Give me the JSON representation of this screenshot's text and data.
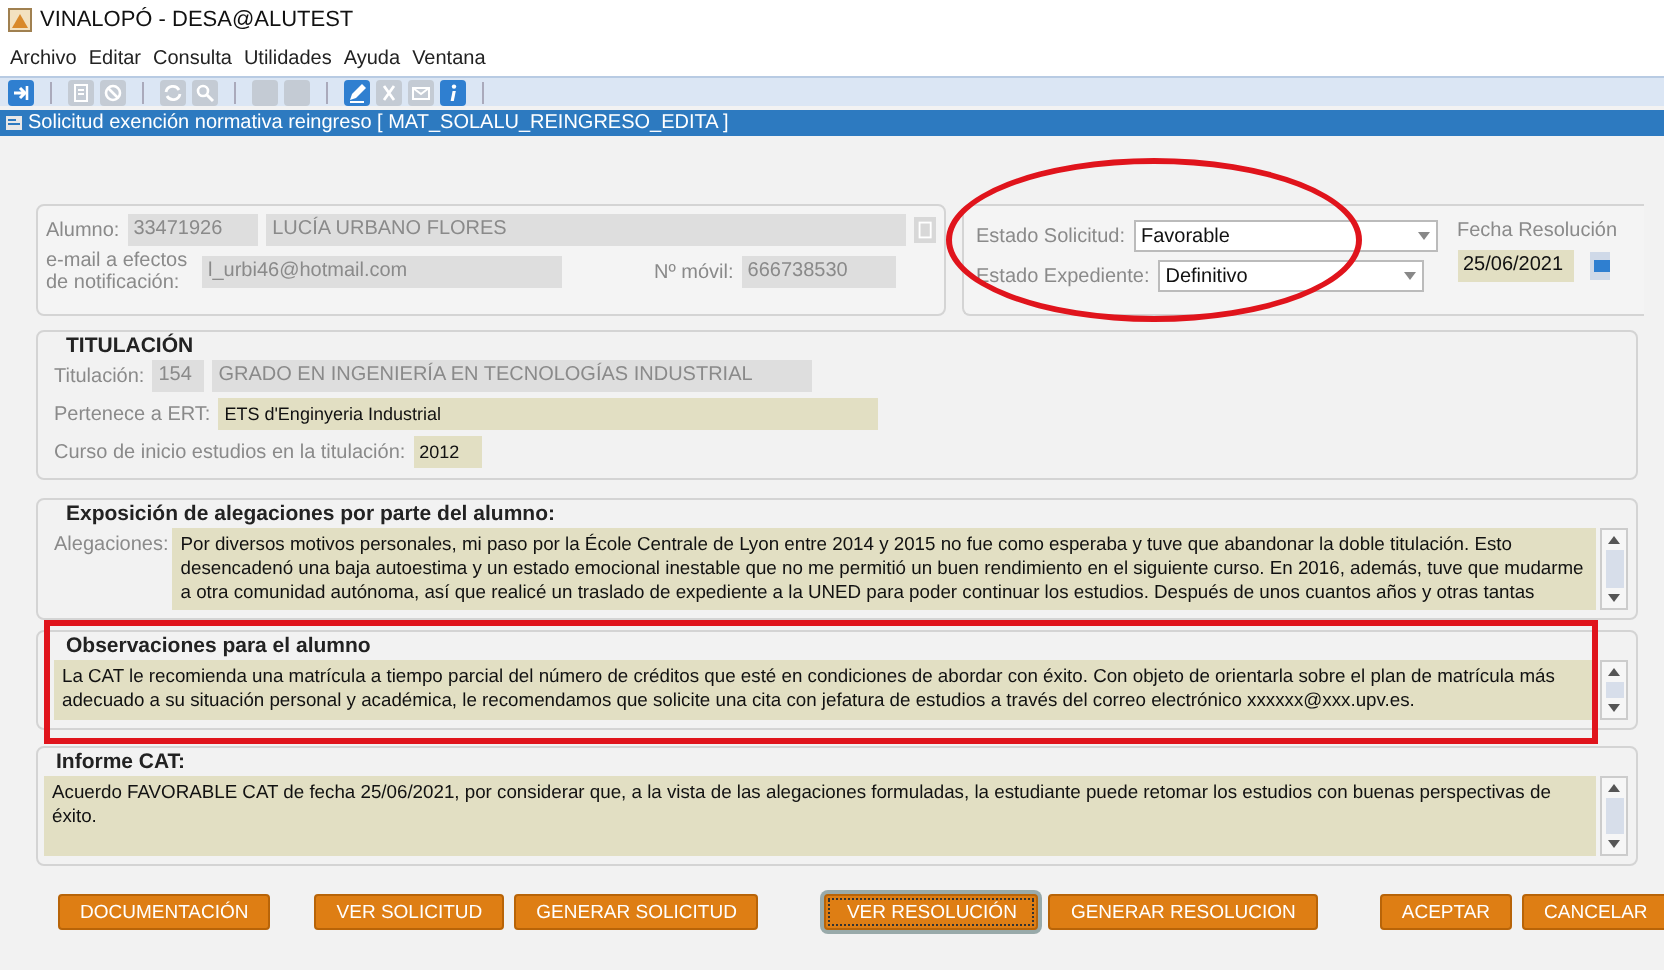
{
  "window": {
    "title": "VINALOPÓ - DESA@ALUTEST"
  },
  "menu": [
    "Archivo",
    "Editar",
    "Consulta",
    "Utilidades",
    "Ayuda",
    "Ventana"
  ],
  "toolbar": [
    {
      "kind": "exit",
      "disabled": false
    },
    {
      "kind": "separator"
    },
    {
      "kind": "list",
      "disabled": true
    },
    {
      "kind": "cancel",
      "disabled": true
    },
    {
      "kind": "separator"
    },
    {
      "kind": "refresh",
      "disabled": true
    },
    {
      "kind": "search",
      "disabled": true
    },
    {
      "kind": "separator"
    },
    {
      "kind": "blank",
      "disabled": true
    },
    {
      "kind": "blank",
      "disabled": true
    },
    {
      "kind": "separator"
    },
    {
      "kind": "edit",
      "disabled": false
    },
    {
      "kind": "excel",
      "disabled": true
    },
    {
      "kind": "mail",
      "disabled": true
    },
    {
      "kind": "info",
      "disabled": false
    },
    {
      "kind": "separator"
    }
  ],
  "form": {
    "title": "Solicitud exención normativa reingreso [ MAT_SOLALU_REINGRESO_EDITA ]"
  },
  "student": {
    "label": "Alumno:",
    "id": "33471926",
    "name": "LUCÍA URBANO FLORES",
    "email_label": "e-mail a efectos de notificación:",
    "email": "l_urbi46@hotmail.com",
    "mobile_label": "Nº móvil:",
    "mobile": "666738530"
  },
  "status": {
    "request_label": "Estado Solicitud:",
    "request": "Favorable",
    "file_label": "Estado Expediente:",
    "file": "Definitivo",
    "date_label": "Fecha Resolución",
    "date": "25/06/2021"
  },
  "degree": {
    "heading": "TITULACIÓN",
    "label": "Titulación:",
    "code": "154",
    "name": "GRADO EN INGENIERÍA EN TECNOLOGÍAS INDUSTRIAL",
    "ert_label": "Pertenece a ERT:",
    "ert": "ETS d'Enginyeria Industrial",
    "start_label": "Curso de inicio estudios en la titulación:",
    "start": "2012"
  },
  "allegations": {
    "heading": "Exposición de alegaciones por parte del alumno:",
    "label": "Alegaciones:",
    "text": "Por diversos motivos personales, mi paso por la École Centrale de Lyon entre 2014 y 2015 no fue como esperaba y tuve que abandonar la doble titulación. Esto desencadenó una baja autoestima y un estado emocional inestable que no me permitió un buen rendimiento en el siguiente curso. En 2016, además, tuve que mudarme a otra comunidad autónoma, así que realicé un traslado de expediente a la UNED para poder continuar los estudios. Después de unos cuantos años y otras tantas"
  },
  "observations": {
    "heading": "Observaciones para el alumno",
    "text": "La CAT le recomienda una matrícula a tiempo parcial del número de créditos que esté en condiciones de abordar con éxito. Con objeto de orientarla sobre el plan de matrícula más adecuado a su situación personal y académica, le recomendamos que solicite una cita con jefatura de estudios a través del correo electrónico xxxxxx@xxx.upv.es."
  },
  "report": {
    "heading": "Informe CAT:",
    "text": "Acuerdo FAVORABLE CAT de fecha 25/06/2021, por considerar que, a la vista de las alegaciones formuladas,  la estudiante puede retomar los estudios con buenas perspectivas de éxito."
  },
  "buttons": [
    {
      "label": "DOCUMENTACIÓN",
      "focused": false
    },
    {
      "label": "VER SOLICITUD",
      "focused": false
    },
    {
      "label": "GENERAR SOLICITUD",
      "focused": false
    },
    {
      "label": "VER RESOLUCIÓN",
      "focused": true
    },
    {
      "label": "GENERAR RESOLUCION",
      "focused": false
    },
    {
      "label": "ACEPTAR",
      "focused": false
    },
    {
      "label": "CANCELAR",
      "focused": false
    }
  ],
  "annotations": [
    {
      "kind": "ellipse"
    },
    {
      "kind": "rectangle"
    }
  ]
}
